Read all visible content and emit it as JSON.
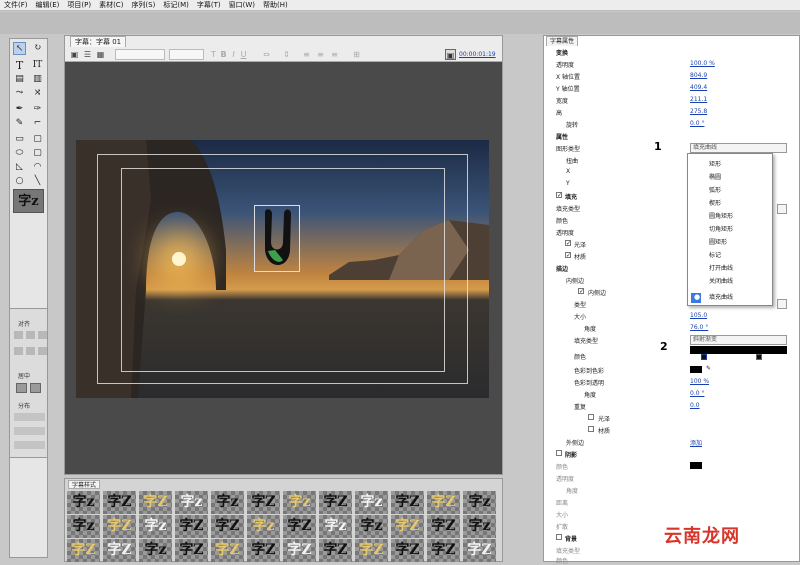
{
  "menubar": {
    "items": [
      "文件(F)",
      "编辑(E)",
      "项目(P)",
      "素材(C)",
      "序列(S)",
      "标记(M)",
      "字幕(T)",
      "窗口(W)",
      "帮助(H)"
    ]
  },
  "editor": {
    "tab_label": "字幕：字幕 01",
    "timecode": "00:00:01:19"
  },
  "tools": {
    "type_tool": "T",
    "vertical_type_tool": "IT",
    "style_preview": "字z"
  },
  "align": {
    "section_align": "对齐",
    "section_center": "居中",
    "section_distribute": "分布"
  },
  "styles": {
    "tab_label": "字幕样式",
    "row1": [
      "字z",
      "字Z",
      "字Z",
      "字z",
      "字z",
      "字Z",
      "字z",
      "字Z",
      "字z",
      "字Z",
      "字Z",
      "字z"
    ],
    "row2": [
      "字z",
      "字Z",
      "字z",
      "字Z",
      "字Z",
      "字z",
      "字Z",
      "字z",
      "字z",
      "字Z",
      "字Z",
      "字z"
    ],
    "row3": [
      "字Z",
      "字Z",
      "字z",
      "字Z",
      "字Z",
      "字Z",
      "字Z",
      "字Z",
      "字Z",
      "字Z",
      "字Z",
      "字Z"
    ]
  },
  "props": {
    "tab_label": "字幕属性",
    "transform": {
      "header": "变换",
      "opacity_label": "透明度",
      "opacity": "100.0 %",
      "x_label": "X 轴位置",
      "x": "804.9",
      "y_label": "Y 轴位置",
      "y": "409.4",
      "w_label": "宽度",
      "w": "211.1",
      "h_label": "高",
      "h": "275.8",
      "rot_label": "旋转",
      "rot": "0.0 °"
    },
    "properties": {
      "header": "属性",
      "shape_type_label": "图形类型",
      "shape_type": "填充曲线",
      "distort_label": "扭曲",
      "dx_label": "X",
      "dy_label": "Y"
    },
    "fill": {
      "header": "填充",
      "fill_type_label": "填充类型",
      "color_label": "颜色",
      "opacity_label": "透明度",
      "sheen_label": "光泽",
      "texture_label": "材质"
    },
    "stroke": {
      "header": "描边",
      "inner": "内侧边",
      "inner_item": "内侧边",
      "type_label": "类型",
      "size_label": "大小",
      "size": "105.0",
      "angle_label": "角度",
      "angle": "76.0 °",
      "fill_type_label": "填充类型",
      "fill_type": "斜射渐变",
      "color_label": "颜色",
      "color_stop_color": "色彩到色彩",
      "color_stop_opacity": "色彩到透明",
      "opacity_val": "100 %",
      "angle2_label": "角度",
      "angle2": "0.0 °",
      "repeat_label": "重复",
      "repeat": "0.0",
      "sheen_label": "光泽",
      "texture_label": "材质",
      "outer": "外侧边",
      "outer_add": "添加"
    },
    "shadow": {
      "header": "阴影",
      "color_label": "颜色",
      "opacity_label": "透明度",
      "angle_label": "角度",
      "distance_label": "距离",
      "size_label": "大小",
      "spread_label": "扩散"
    },
    "background": {
      "header": "背景",
      "fill_type_label": "填充类型",
      "color_label": "颜色"
    }
  },
  "dropdown": {
    "items": [
      "矩形",
      "椭圆",
      "弧形",
      "楔形",
      "圆角矩形",
      "切角矩形",
      "圆矩形",
      "标记",
      "打开曲线",
      "关闭曲线",
      "填充曲线"
    ],
    "selected": "填充曲线"
  },
  "annotations": {
    "one": "1",
    "two": "2"
  },
  "watermark": "云南龙网",
  "colors": {
    "panel_bg": "#e6e6e6",
    "accent_blue": "#1a3fb0",
    "selection": "#3b7be0"
  }
}
